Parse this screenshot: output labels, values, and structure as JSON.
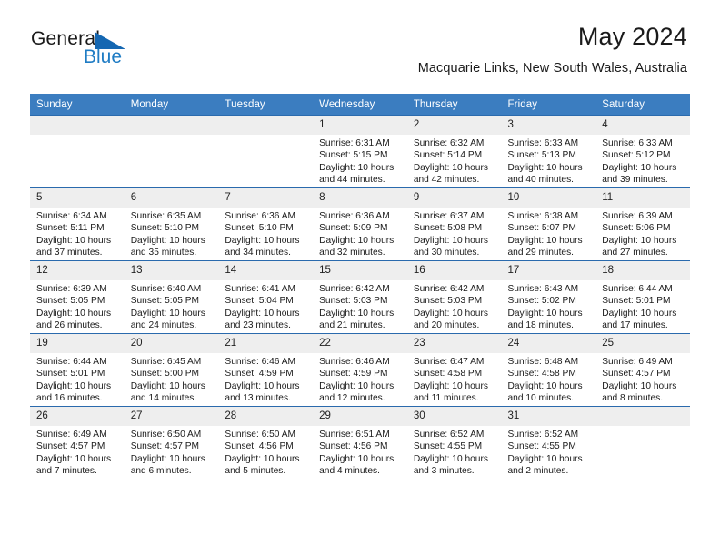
{
  "brand": {
    "name_part1": "General",
    "name_part2": "Blue",
    "triangle_color": "#1567b2",
    "blue_text_color": "#1f7cc4"
  },
  "header": {
    "title": "May 2024",
    "subtitle": "Macquarie Links, New South Wales, Australia"
  },
  "theme": {
    "header_bg": "#3b7dc0",
    "row_border": "#2a6aad",
    "daynum_bg": "#eeeeee"
  },
  "calendar": {
    "weekday_headers": [
      "Sunday",
      "Monday",
      "Tuesday",
      "Wednesday",
      "Thursday",
      "Friday",
      "Saturday"
    ],
    "weeks": [
      [
        {
          "day": "",
          "sunrise": "",
          "sunset": "",
          "daylight_line1": "",
          "daylight_line2": ""
        },
        {
          "day": "",
          "sunrise": "",
          "sunset": "",
          "daylight_line1": "",
          "daylight_line2": ""
        },
        {
          "day": "",
          "sunrise": "",
          "sunset": "",
          "daylight_line1": "",
          "daylight_line2": ""
        },
        {
          "day": "1",
          "sunrise": "Sunrise: 6:31 AM",
          "sunset": "Sunset: 5:15 PM",
          "daylight_line1": "Daylight: 10 hours",
          "daylight_line2": "and 44 minutes."
        },
        {
          "day": "2",
          "sunrise": "Sunrise: 6:32 AM",
          "sunset": "Sunset: 5:14 PM",
          "daylight_line1": "Daylight: 10 hours",
          "daylight_line2": "and 42 minutes."
        },
        {
          "day": "3",
          "sunrise": "Sunrise: 6:33 AM",
          "sunset": "Sunset: 5:13 PM",
          "daylight_line1": "Daylight: 10 hours",
          "daylight_line2": "and 40 minutes."
        },
        {
          "day": "4",
          "sunrise": "Sunrise: 6:33 AM",
          "sunset": "Sunset: 5:12 PM",
          "daylight_line1": "Daylight: 10 hours",
          "daylight_line2": "and 39 minutes."
        }
      ],
      [
        {
          "day": "5",
          "sunrise": "Sunrise: 6:34 AM",
          "sunset": "Sunset: 5:11 PM",
          "daylight_line1": "Daylight: 10 hours",
          "daylight_line2": "and 37 minutes."
        },
        {
          "day": "6",
          "sunrise": "Sunrise: 6:35 AM",
          "sunset": "Sunset: 5:10 PM",
          "daylight_line1": "Daylight: 10 hours",
          "daylight_line2": "and 35 minutes."
        },
        {
          "day": "7",
          "sunrise": "Sunrise: 6:36 AM",
          "sunset": "Sunset: 5:10 PM",
          "daylight_line1": "Daylight: 10 hours",
          "daylight_line2": "and 34 minutes."
        },
        {
          "day": "8",
          "sunrise": "Sunrise: 6:36 AM",
          "sunset": "Sunset: 5:09 PM",
          "daylight_line1": "Daylight: 10 hours",
          "daylight_line2": "and 32 minutes."
        },
        {
          "day": "9",
          "sunrise": "Sunrise: 6:37 AM",
          "sunset": "Sunset: 5:08 PM",
          "daylight_line1": "Daylight: 10 hours",
          "daylight_line2": "and 30 minutes."
        },
        {
          "day": "10",
          "sunrise": "Sunrise: 6:38 AM",
          "sunset": "Sunset: 5:07 PM",
          "daylight_line1": "Daylight: 10 hours",
          "daylight_line2": "and 29 minutes."
        },
        {
          "day": "11",
          "sunrise": "Sunrise: 6:39 AM",
          "sunset": "Sunset: 5:06 PM",
          "daylight_line1": "Daylight: 10 hours",
          "daylight_line2": "and 27 minutes."
        }
      ],
      [
        {
          "day": "12",
          "sunrise": "Sunrise: 6:39 AM",
          "sunset": "Sunset: 5:05 PM",
          "daylight_line1": "Daylight: 10 hours",
          "daylight_line2": "and 26 minutes."
        },
        {
          "day": "13",
          "sunrise": "Sunrise: 6:40 AM",
          "sunset": "Sunset: 5:05 PM",
          "daylight_line1": "Daylight: 10 hours",
          "daylight_line2": "and 24 minutes."
        },
        {
          "day": "14",
          "sunrise": "Sunrise: 6:41 AM",
          "sunset": "Sunset: 5:04 PM",
          "daylight_line1": "Daylight: 10 hours",
          "daylight_line2": "and 23 minutes."
        },
        {
          "day": "15",
          "sunrise": "Sunrise: 6:42 AM",
          "sunset": "Sunset: 5:03 PM",
          "daylight_line1": "Daylight: 10 hours",
          "daylight_line2": "and 21 minutes."
        },
        {
          "day": "16",
          "sunrise": "Sunrise: 6:42 AM",
          "sunset": "Sunset: 5:03 PM",
          "daylight_line1": "Daylight: 10 hours",
          "daylight_line2": "and 20 minutes."
        },
        {
          "day": "17",
          "sunrise": "Sunrise: 6:43 AM",
          "sunset": "Sunset: 5:02 PM",
          "daylight_line1": "Daylight: 10 hours",
          "daylight_line2": "and 18 minutes."
        },
        {
          "day": "18",
          "sunrise": "Sunrise: 6:44 AM",
          "sunset": "Sunset: 5:01 PM",
          "daylight_line1": "Daylight: 10 hours",
          "daylight_line2": "and 17 minutes."
        }
      ],
      [
        {
          "day": "19",
          "sunrise": "Sunrise: 6:44 AM",
          "sunset": "Sunset: 5:01 PM",
          "daylight_line1": "Daylight: 10 hours",
          "daylight_line2": "and 16 minutes."
        },
        {
          "day": "20",
          "sunrise": "Sunrise: 6:45 AM",
          "sunset": "Sunset: 5:00 PM",
          "daylight_line1": "Daylight: 10 hours",
          "daylight_line2": "and 14 minutes."
        },
        {
          "day": "21",
          "sunrise": "Sunrise: 6:46 AM",
          "sunset": "Sunset: 4:59 PM",
          "daylight_line1": "Daylight: 10 hours",
          "daylight_line2": "and 13 minutes."
        },
        {
          "day": "22",
          "sunrise": "Sunrise: 6:46 AM",
          "sunset": "Sunset: 4:59 PM",
          "daylight_line1": "Daylight: 10 hours",
          "daylight_line2": "and 12 minutes."
        },
        {
          "day": "23",
          "sunrise": "Sunrise: 6:47 AM",
          "sunset": "Sunset: 4:58 PM",
          "daylight_line1": "Daylight: 10 hours",
          "daylight_line2": "and 11 minutes."
        },
        {
          "day": "24",
          "sunrise": "Sunrise: 6:48 AM",
          "sunset": "Sunset: 4:58 PM",
          "daylight_line1": "Daylight: 10 hours",
          "daylight_line2": "and 10 minutes."
        },
        {
          "day": "25",
          "sunrise": "Sunrise: 6:49 AM",
          "sunset": "Sunset: 4:57 PM",
          "daylight_line1": "Daylight: 10 hours",
          "daylight_line2": "and 8 minutes."
        }
      ],
      [
        {
          "day": "26",
          "sunrise": "Sunrise: 6:49 AM",
          "sunset": "Sunset: 4:57 PM",
          "daylight_line1": "Daylight: 10 hours",
          "daylight_line2": "and 7 minutes."
        },
        {
          "day": "27",
          "sunrise": "Sunrise: 6:50 AM",
          "sunset": "Sunset: 4:57 PM",
          "daylight_line1": "Daylight: 10 hours",
          "daylight_line2": "and 6 minutes."
        },
        {
          "day": "28",
          "sunrise": "Sunrise: 6:50 AM",
          "sunset": "Sunset: 4:56 PM",
          "daylight_line1": "Daylight: 10 hours",
          "daylight_line2": "and 5 minutes."
        },
        {
          "day": "29",
          "sunrise": "Sunrise: 6:51 AM",
          "sunset": "Sunset: 4:56 PM",
          "daylight_line1": "Daylight: 10 hours",
          "daylight_line2": "and 4 minutes."
        },
        {
          "day": "30",
          "sunrise": "Sunrise: 6:52 AM",
          "sunset": "Sunset: 4:55 PM",
          "daylight_line1": "Daylight: 10 hours",
          "daylight_line2": "and 3 minutes."
        },
        {
          "day": "31",
          "sunrise": "Sunrise: 6:52 AM",
          "sunset": "Sunset: 4:55 PM",
          "daylight_line1": "Daylight: 10 hours",
          "daylight_line2": "and 2 minutes."
        },
        {
          "day": "",
          "sunrise": "",
          "sunset": "",
          "daylight_line1": "",
          "daylight_line2": ""
        }
      ]
    ]
  }
}
